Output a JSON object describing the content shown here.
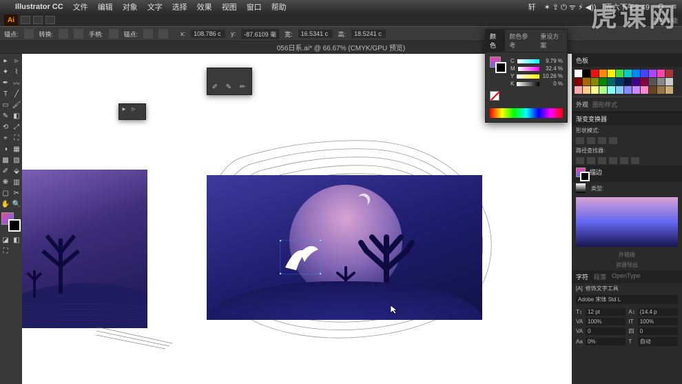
{
  "mac_menu": {
    "app": "Illustrator CC",
    "items": [
      "文件",
      "编辑",
      "对象",
      "文字",
      "选择",
      "效果",
      "视图",
      "窗口",
      "帮助"
    ],
    "right": {
      "status": "轩",
      "icons": "✶ ⇪ ⏻ ᯤ ⚡︎ ◀))",
      "clock": "周六下午5:49"
    }
  },
  "app_strip": {
    "badge": "Ai",
    "right_label": "基本功能"
  },
  "control_bar": {
    "anchor_label": "锚点:",
    "convert_label": "转换:",
    "handle_label": "手柄:",
    "anchors_label": "锚点:",
    "x_label": "x:",
    "x_val": "108.786 c",
    "y_label": "y:",
    "y_val": "-87.6109 毫",
    "w_label": "宽:",
    "w_val": "16.5341 c",
    "h_label": "高:",
    "h_val": "18.5241 c"
  },
  "tab": {
    "title": "056日系.ai* @ 66.67% (CMYK/GPU 预览)"
  },
  "color_panel": {
    "tabs": [
      "颜色",
      "颜色参考",
      "重设方案"
    ],
    "sliders": [
      {
        "label": "C",
        "val": "9.79 %"
      },
      {
        "label": "M",
        "val": "32.4 %"
      },
      {
        "label": "Y",
        "val": "10.26 %"
      },
      {
        "label": "K",
        "val": "0 %"
      }
    ]
  },
  "right": {
    "color_title": "色板",
    "appearance": "外观",
    "graphic_styles": "图形样式",
    "libs": "渐变变换器",
    "shape_title": "形状模式:",
    "pathfinder": "路径查找器:",
    "stroke_title": "描边",
    "gradient_label": "类型:",
    "links_label": "外链接",
    "asset_label": "资源导出",
    "char_title": "字符",
    "paragraph": "段落",
    "opentype": "OpenType",
    "touch_type": "修饰文字工具",
    "font": "Adobe 宋体 Std L",
    "char": {
      "size_l": "T↕",
      "size_v": "12 pt",
      "lead_l": "A↕",
      "lead_v": "(14.4 p",
      "kern_l": "VA",
      "kern_v": "100%",
      "track_l": "IT",
      "track_v": "100%",
      "vert_l": "VA",
      "vert_v": "0",
      "horiz_l": "四",
      "horiz_v": "0",
      "base_l": "Aa",
      "base_v": "0%",
      "rotate_l": "T",
      "rotate_v": "自动"
    }
  },
  "watermark": "虎课网"
}
